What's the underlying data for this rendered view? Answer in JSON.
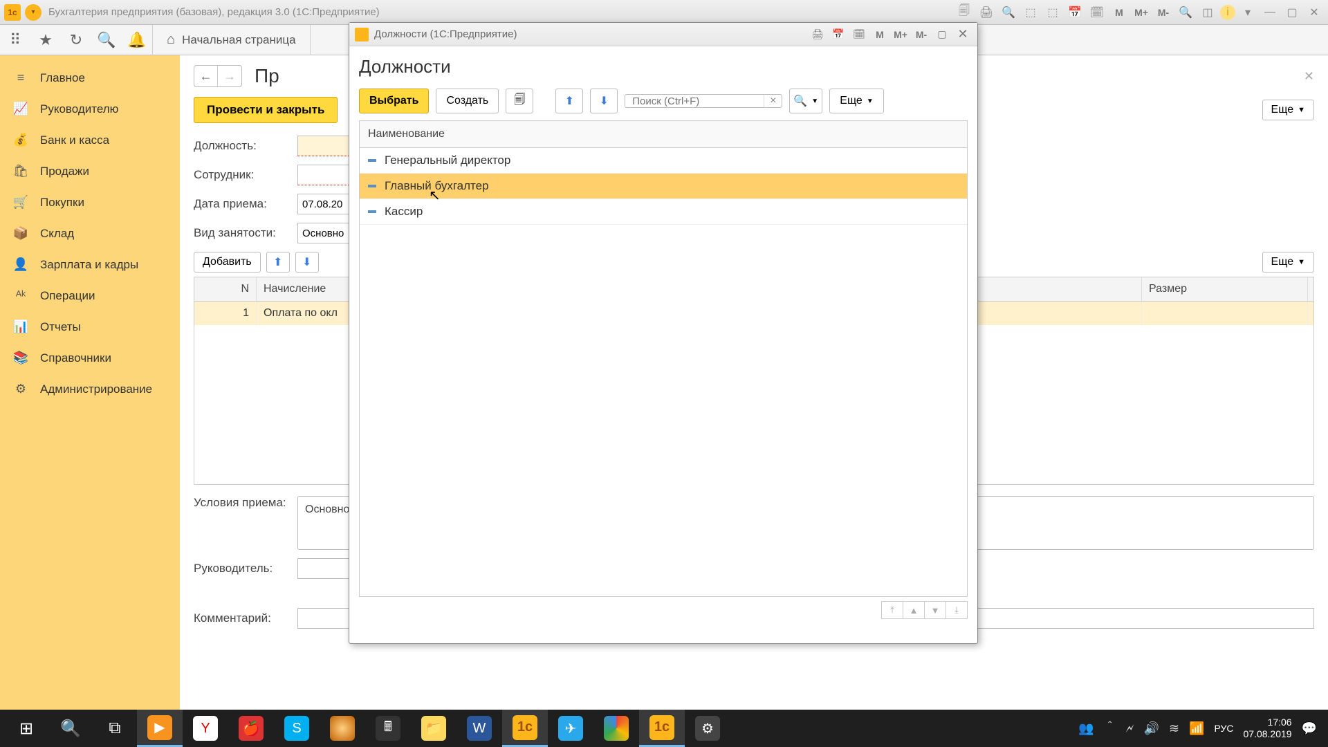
{
  "app": {
    "title": "Бухгалтерия предприятия (базовая), редакция 3.0  (1С:Предприятие)",
    "m1": "M",
    "m2": "M+",
    "m3": "M-"
  },
  "toolbar": {
    "home_tab": "Начальная страница"
  },
  "sidebar": {
    "items": [
      {
        "icon": "≡",
        "label": "Главное"
      },
      {
        "icon": "📈",
        "label": "Руководителю"
      },
      {
        "icon": "💰",
        "label": "Банк и касса"
      },
      {
        "icon": "🛍",
        "label": "Продажи"
      },
      {
        "icon": "🛒",
        "label": "Покупки"
      },
      {
        "icon": "📦",
        "label": "Склад"
      },
      {
        "icon": "👤",
        "label": "Зарплата и кадры"
      },
      {
        "icon": "ᴬᵏ",
        "label": "Операции"
      },
      {
        "icon": "📊",
        "label": "Отчеты"
      },
      {
        "icon": "📚",
        "label": "Справочники"
      },
      {
        "icon": "⚙",
        "label": "Администрирование"
      }
    ]
  },
  "page": {
    "title": "Пр",
    "post_close": "Провести и закрыть",
    "more": "Еще",
    "labels": {
      "position": "Должность:",
      "employee": "Сотрудник:",
      "date": "Дата приема:",
      "date_value": "07.08.20",
      "emptype": "Вид занятости:",
      "emptype_value": "Основно",
      "add": "Добавить",
      "conditions": "Условия приема:",
      "conditions_value": "Основно",
      "manager": "Руководитель:",
      "comment": "Комментарий:"
    },
    "table": {
      "col_n": "N",
      "col_accrual": "Начисление",
      "col_size": "Размер",
      "row1_n": "1",
      "row1_accrual": "Оплата по окл"
    }
  },
  "modal": {
    "window_title": "Должности  (1С:Предприятие)",
    "title": "Должности",
    "m1": "M",
    "m2": "M+",
    "m3": "M-",
    "select": "Выбрать",
    "create": "Создать",
    "search_placeholder": "Поиск (Ctrl+F)",
    "more": "Еще",
    "column": "Наименование",
    "items": [
      "Генеральный директор",
      "Главный бухгалтер",
      "Кассир"
    ]
  },
  "taskbar": {
    "lang": "РУС",
    "time": "17:06",
    "date": "07.08.2019"
  }
}
